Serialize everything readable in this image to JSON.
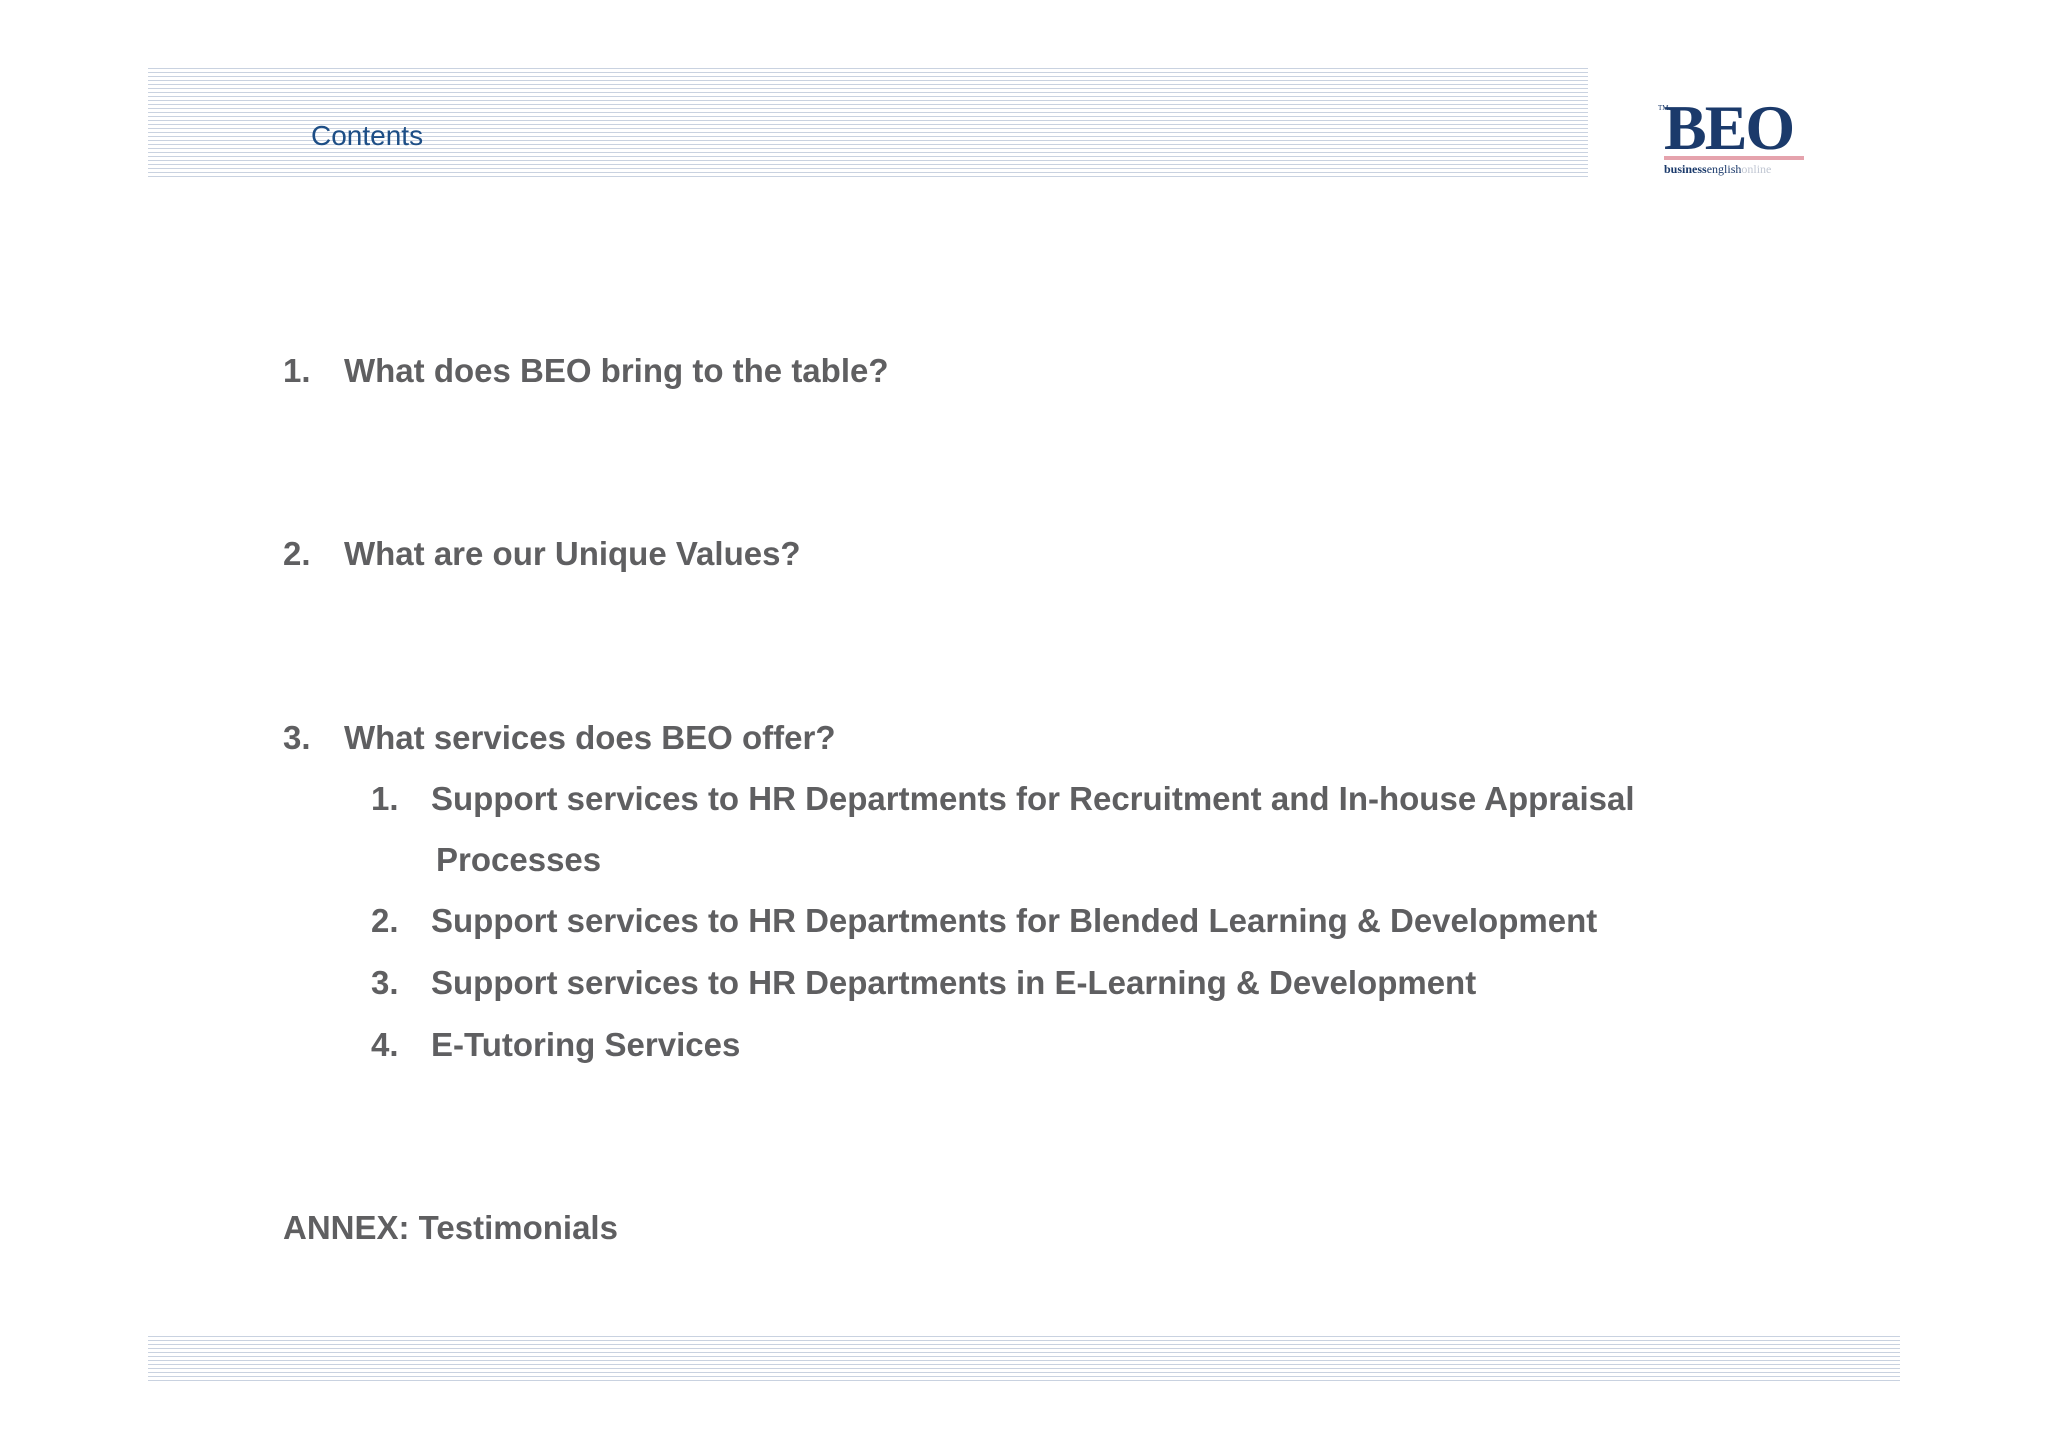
{
  "header": {
    "title": "Contents",
    "logo": {
      "tm": "TM",
      "wordmark": "BEO",
      "sub_bold": "business",
      "sub_mid": "english",
      "sub_light": "online"
    }
  },
  "toc": {
    "item1": {
      "num": "1.",
      "text": "What does BEO bring to the table?"
    },
    "item2": {
      "num": "2.",
      "text": "What are our Unique Values?"
    },
    "item3": {
      "num": "3.",
      "text": "What services does BEO offer?",
      "sub": [
        {
          "num": "1.",
          "text": "Support services to HR Departments for Recruitment and In-house Appraisal",
          "cont": "Processes"
        },
        {
          "num": "2.",
          "text": "Support services to HR Departments for Blended Learning & Development"
        },
        {
          "num": "3.",
          "text": "Support services to HR Departments in E-Learning & Development"
        },
        {
          "num": "4.",
          "text": "E-Tutoring Services"
        }
      ]
    },
    "annex": "ANNEX: Testimonials"
  },
  "colors": {
    "title_blue": "#1d4e86",
    "body_gray": "#5f5f61",
    "stripe": "#c9d2e0",
    "logo_navy": "#1b3a6b",
    "logo_pink": "#e5a3ad"
  }
}
